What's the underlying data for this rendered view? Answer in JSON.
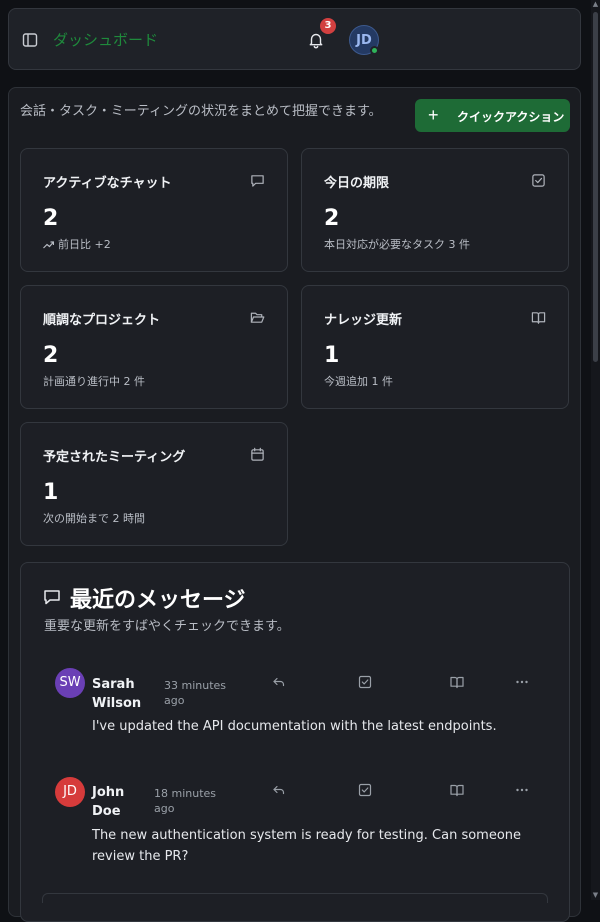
{
  "header": {
    "app_title": "ダッシュボード",
    "notification_count": "3",
    "user_initials": "JD"
  },
  "intro": {
    "text": "会話・タスク・ミーティングの状況をまとめて把握できます。",
    "quick_action_label": "クイックアクション"
  },
  "cards": [
    {
      "title": "アクティブなチャット",
      "value": "2",
      "sub": "前日比 +2",
      "icon": "message-icon"
    },
    {
      "title": "今日の期限",
      "value": "2",
      "sub": "本日対応が必要なタスク 3 件",
      "icon": "checkbox-icon"
    },
    {
      "title": "順調なプロジェクト",
      "value": "2",
      "sub": "計画通り進行中 2 件",
      "icon": "folder-open-icon"
    },
    {
      "title": "ナレッジ更新",
      "value": "1",
      "sub": "今週追加 1 件",
      "icon": "book-icon"
    },
    {
      "title": "予定されたミーティング",
      "value": "1",
      "sub": "次の開始まで 2 時間",
      "icon": "calendar-icon"
    }
  ],
  "messages": {
    "title": "最近のメッセージ",
    "subtitle": "重要な更新をすばやくチェックできます。",
    "items": [
      {
        "initials": "SW",
        "name": "Sarah Wilson",
        "time": "33 minutes ago",
        "text": "I've updated the API documentation with the latest endpoints.",
        "avatar_color": "#6a3fb5"
      },
      {
        "initials": "JD",
        "name": "John Doe",
        "time": "18 minutes ago",
        "text": "The new authentication system is ready for testing. Can someone review the PR?",
        "avatar_color": "#d63b3b"
      }
    ]
  },
  "colors": {
    "accent": "#1e6b36",
    "online": "#2fb45a",
    "badge": "#d24040"
  }
}
